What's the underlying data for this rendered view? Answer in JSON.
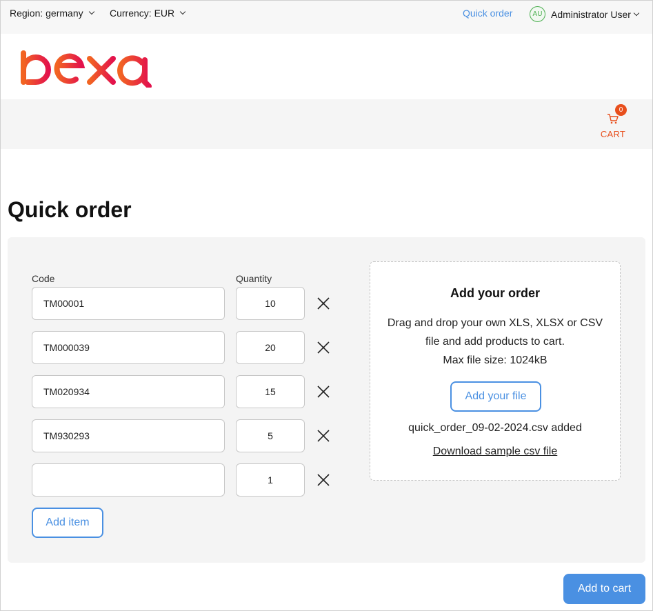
{
  "topbar": {
    "region": "Region: germany",
    "currency": "Currency: EUR",
    "quick_order": "Quick order",
    "user_initials": "AU",
    "user_name": "Administrator User"
  },
  "logo": {
    "alt": "ibexa",
    "color_start": "#f26522",
    "color_end": "#e3124c"
  },
  "cart": {
    "label": "CART",
    "count": "0",
    "icon": "cart-icon"
  },
  "page": {
    "title": "Quick order"
  },
  "form": {
    "code_label": "Code",
    "quantity_label": "Quantity",
    "rows": [
      {
        "code": "TM00001",
        "quantity": "10"
      },
      {
        "code": "TM000039",
        "quantity": "20"
      },
      {
        "code": "TM020934",
        "quantity": "15"
      },
      {
        "code": "TM930293",
        "quantity": "5"
      },
      {
        "code": "",
        "quantity": "1"
      }
    ],
    "add_item": "Add item"
  },
  "upload": {
    "title": "Add your order",
    "description": "Drag and drop your own XLS, XLSX or CSV file and add products to cart.",
    "max_size": "Max file size: 1024kB",
    "button": "Add your file",
    "added_file": "quick_order_09-02-2024.csv added",
    "sample_link": "Download sample csv file"
  },
  "actions": {
    "add_to_cart": "Add to cart"
  },
  "colors": {
    "accent": "#4a90e2",
    "brand": "#e84f1d",
    "avatar": "#4caf50"
  }
}
